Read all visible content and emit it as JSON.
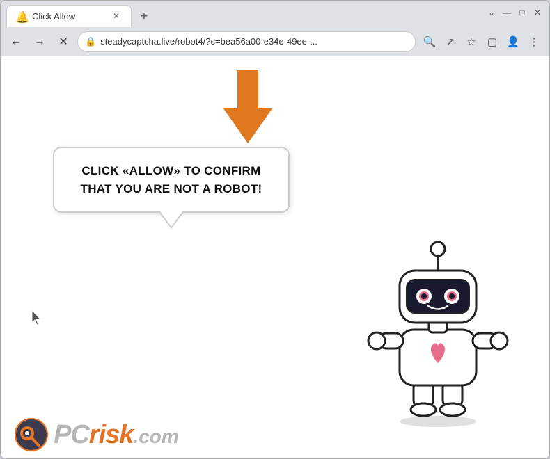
{
  "browser": {
    "tab": {
      "title": "Click Allow",
      "favicon": "🔔"
    },
    "new_tab_label": "+",
    "window_controls": {
      "minimize": "—",
      "maximize": "□",
      "close": "✕"
    },
    "nav": {
      "back": "←",
      "forward": "→",
      "reload": "✕"
    },
    "address": {
      "url": "steadycaptcha.live/robot4/?c=bea56a00-e34e-49ee-...",
      "lock_icon": "🔒"
    },
    "toolbar_icons": {
      "search": "🔍",
      "share": "↗",
      "bookmark": "☆",
      "split": "▢",
      "profile": "👤",
      "menu": "⋮"
    }
  },
  "page": {
    "speech_bubble_text": "CLICK «ALLOW» TO CONFIRM THAT YOU ARE NOT A ROBOT!",
    "arrow_color": "#e07820"
  },
  "watermark": {
    "text_plain": "PC",
    "text_accent": "risk",
    "domain": ".com"
  }
}
